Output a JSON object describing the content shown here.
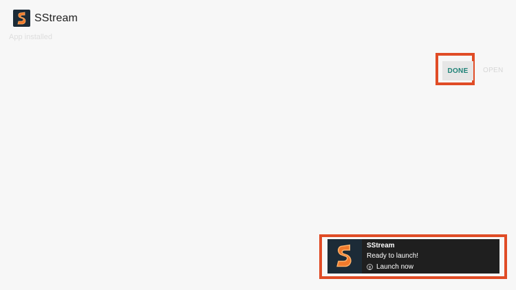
{
  "app": {
    "name": "SStream",
    "status": "App installed",
    "icon": "sstream-logo-icon"
  },
  "actions": {
    "done_label": "DONE",
    "open_label": "OPEN"
  },
  "toast": {
    "title": "SStream",
    "message": "Ready to launch!",
    "action_label": "Launch now",
    "action_icon": "menu-button-icon"
  },
  "colors": {
    "background": "#f7f7f7",
    "done_text": "#1f8277",
    "highlight": "#e04c26",
    "toast_background": "#1f1f1f",
    "icon_background": "#1c2b37",
    "logo_orange": "#f07a2c"
  }
}
